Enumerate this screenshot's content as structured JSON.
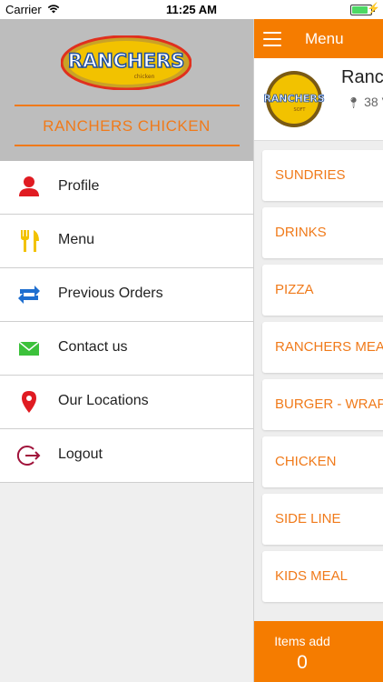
{
  "status": {
    "carrier": "Carrier",
    "time": "11:25 AM"
  },
  "drawer": {
    "brand_logo_text": "RANCHERS",
    "brand_logo_sub": "chicken",
    "brand_name": "RANCHERS CHICKEN",
    "items": [
      {
        "label": "Profile",
        "icon": "person-icon"
      },
      {
        "label": "Menu",
        "icon": "fork-knife-icon"
      },
      {
        "label": "Previous Orders",
        "icon": "repeat-icon"
      },
      {
        "label": "Contact us",
        "icon": "mail-icon"
      },
      {
        "label": "Our Locations",
        "icon": "location-pin-icon"
      },
      {
        "label": "Logout",
        "icon": "logout-icon"
      }
    ]
  },
  "panel": {
    "title": "Menu",
    "shop_name": "Ranc",
    "shop_address": "38 V",
    "shop_logo_text": "RANCHERS",
    "shop_logo_sub": "SOFT",
    "categories": [
      "SUNDRIES",
      "DRINKS",
      "PIZZA",
      "RANCHERS MEA",
      "BURGER - WRAP",
      "CHICKEN",
      "SIDE LINE",
      "KIDS MEAL"
    ],
    "cart_label": "Items add",
    "cart_count": "0"
  },
  "colors": {
    "accent": "#f57c00",
    "brand_text": "#f07a1a"
  }
}
